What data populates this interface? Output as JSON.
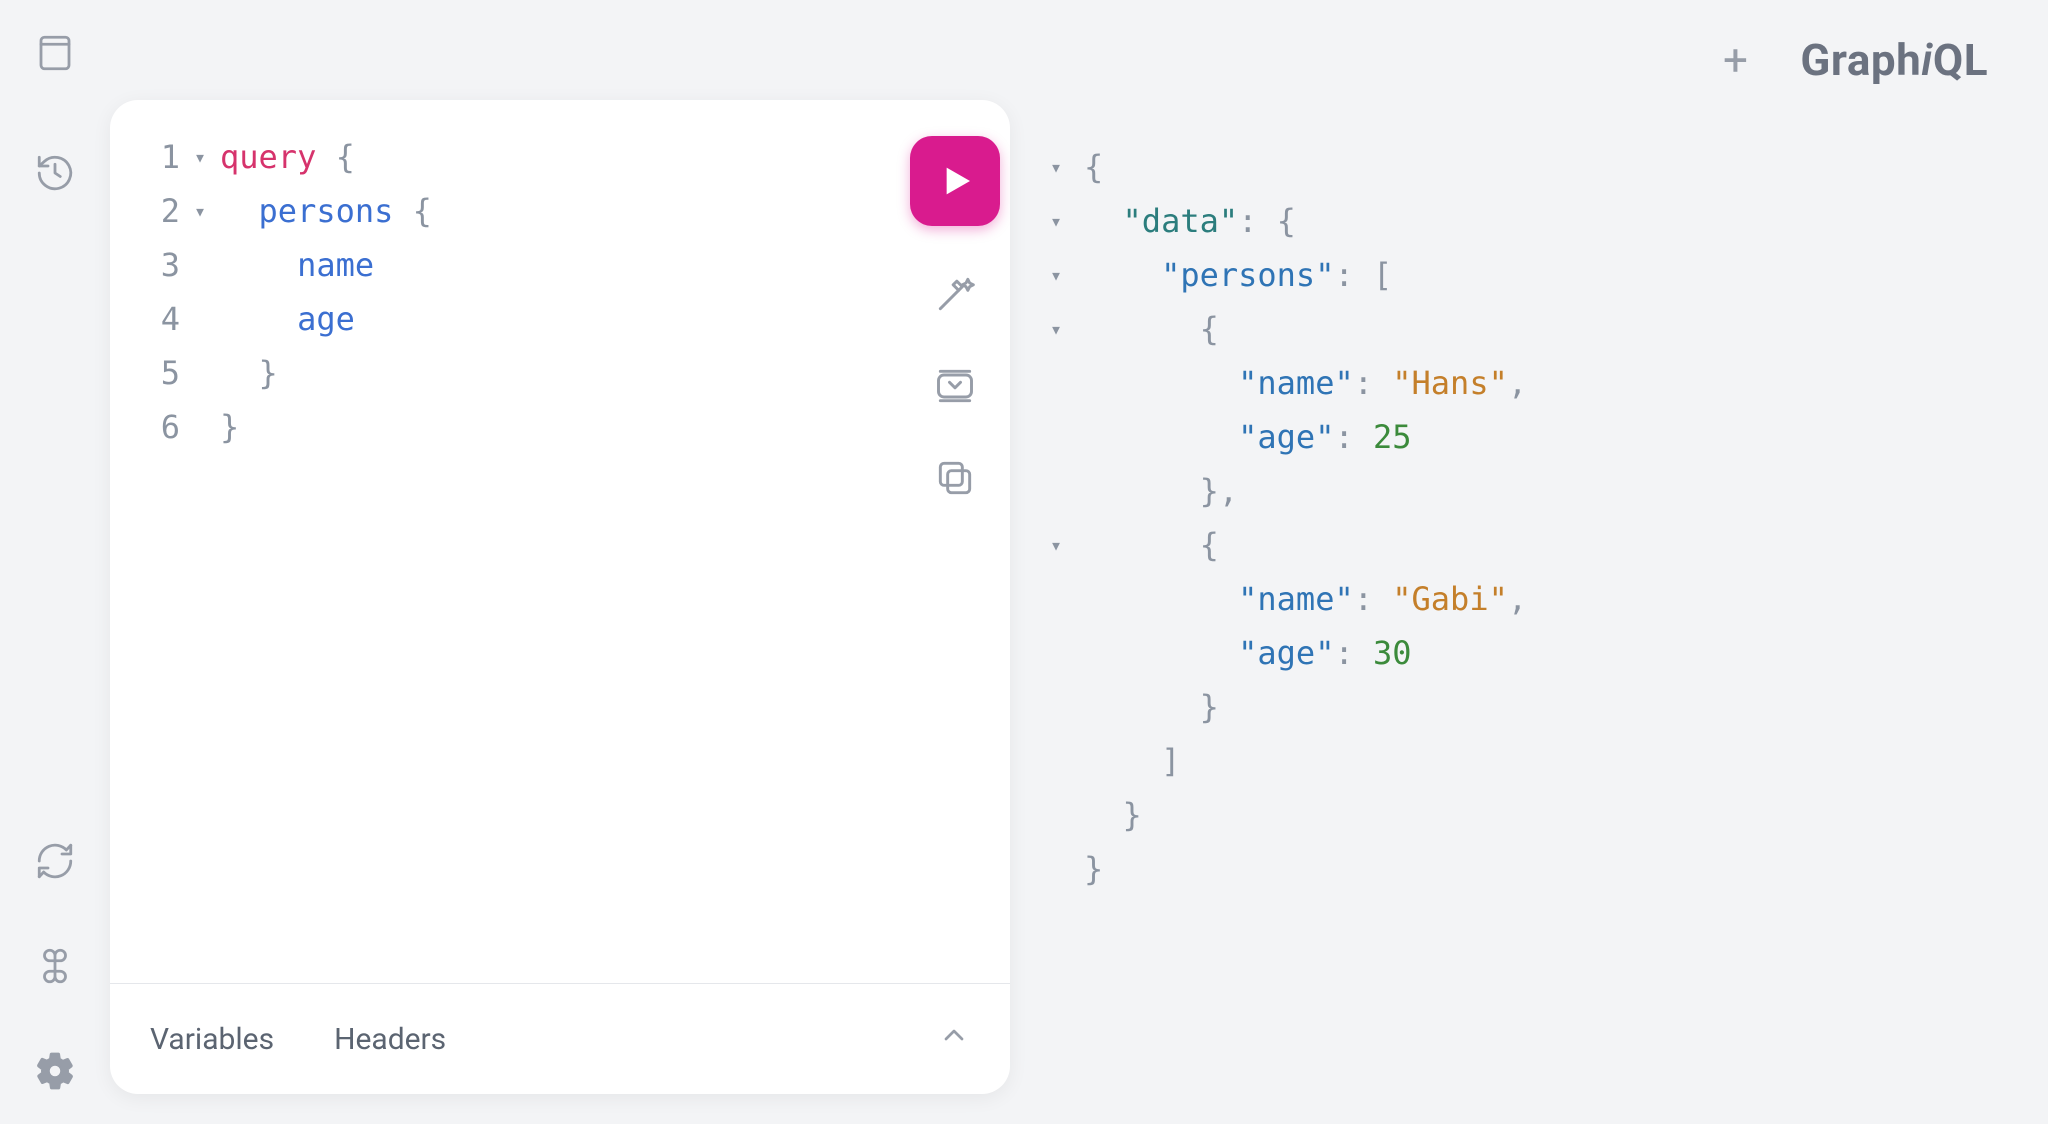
{
  "app": {
    "logo_left": "Graph",
    "logo_i": "i",
    "logo_right": "QL"
  },
  "sidebar": {
    "docs_icon": "docs-icon",
    "history_icon": "history-icon",
    "refresh_icon": "refresh-icon",
    "shortcuts_icon": "keyboard-shortcuts-icon",
    "settings_icon": "settings-icon"
  },
  "topbar": {
    "add_tab_glyph": "+"
  },
  "editor": {
    "lines": [
      {
        "num": "1",
        "fold": "▾",
        "html": "<span class=\"kw\">query</span> {"
      },
      {
        "num": "2",
        "fold": "▾",
        "html": "  <span class=\"fld\">persons</span> {"
      },
      {
        "num": "3",
        "fold": "",
        "html": "    <span class=\"fld\">name</span>"
      },
      {
        "num": "4",
        "fold": "",
        "html": "    <span class=\"fld\">age</span>"
      },
      {
        "num": "5",
        "fold": "",
        "html": "  }"
      },
      {
        "num": "6",
        "fold": "",
        "html": "}"
      }
    ],
    "tools": {
      "run": "run-button",
      "prettify": "prettify-button",
      "merge": "merge-button",
      "copy": "copy-button"
    },
    "footer": {
      "variables_label": "Variables",
      "headers_label": "Headers",
      "chevron": "collapse"
    }
  },
  "response": {
    "lines": [
      {
        "fold": "▾",
        "html": "{"
      },
      {
        "fold": "▾",
        "html": "  <span class=\"key teal\">\"data\"</span>: {"
      },
      {
        "fold": "▾",
        "html": "    <span class=\"key\">\"persons\"</span>: ["
      },
      {
        "fold": "▾",
        "html": "      {"
      },
      {
        "fold": "",
        "html": "        <span class=\"key\">\"name\"</span>: <span class=\"str\">\"Hans\"</span>,"
      },
      {
        "fold": "",
        "html": "        <span class=\"key\">\"age\"</span>: <span class=\"num\">25</span>"
      },
      {
        "fold": "",
        "html": "      },"
      },
      {
        "fold": "▾",
        "html": "      {"
      },
      {
        "fold": "",
        "html": "        <span class=\"key\">\"name\"</span>: <span class=\"str\">\"Gabi\"</span>,"
      },
      {
        "fold": "",
        "html": "        <span class=\"key\">\"age\"</span>: <span class=\"num\">30</span>"
      },
      {
        "fold": "",
        "html": "      }"
      },
      {
        "fold": "",
        "html": "    ]"
      },
      {
        "fold": "",
        "html": "  }"
      },
      {
        "fold": "",
        "html": "}"
      }
    ]
  }
}
